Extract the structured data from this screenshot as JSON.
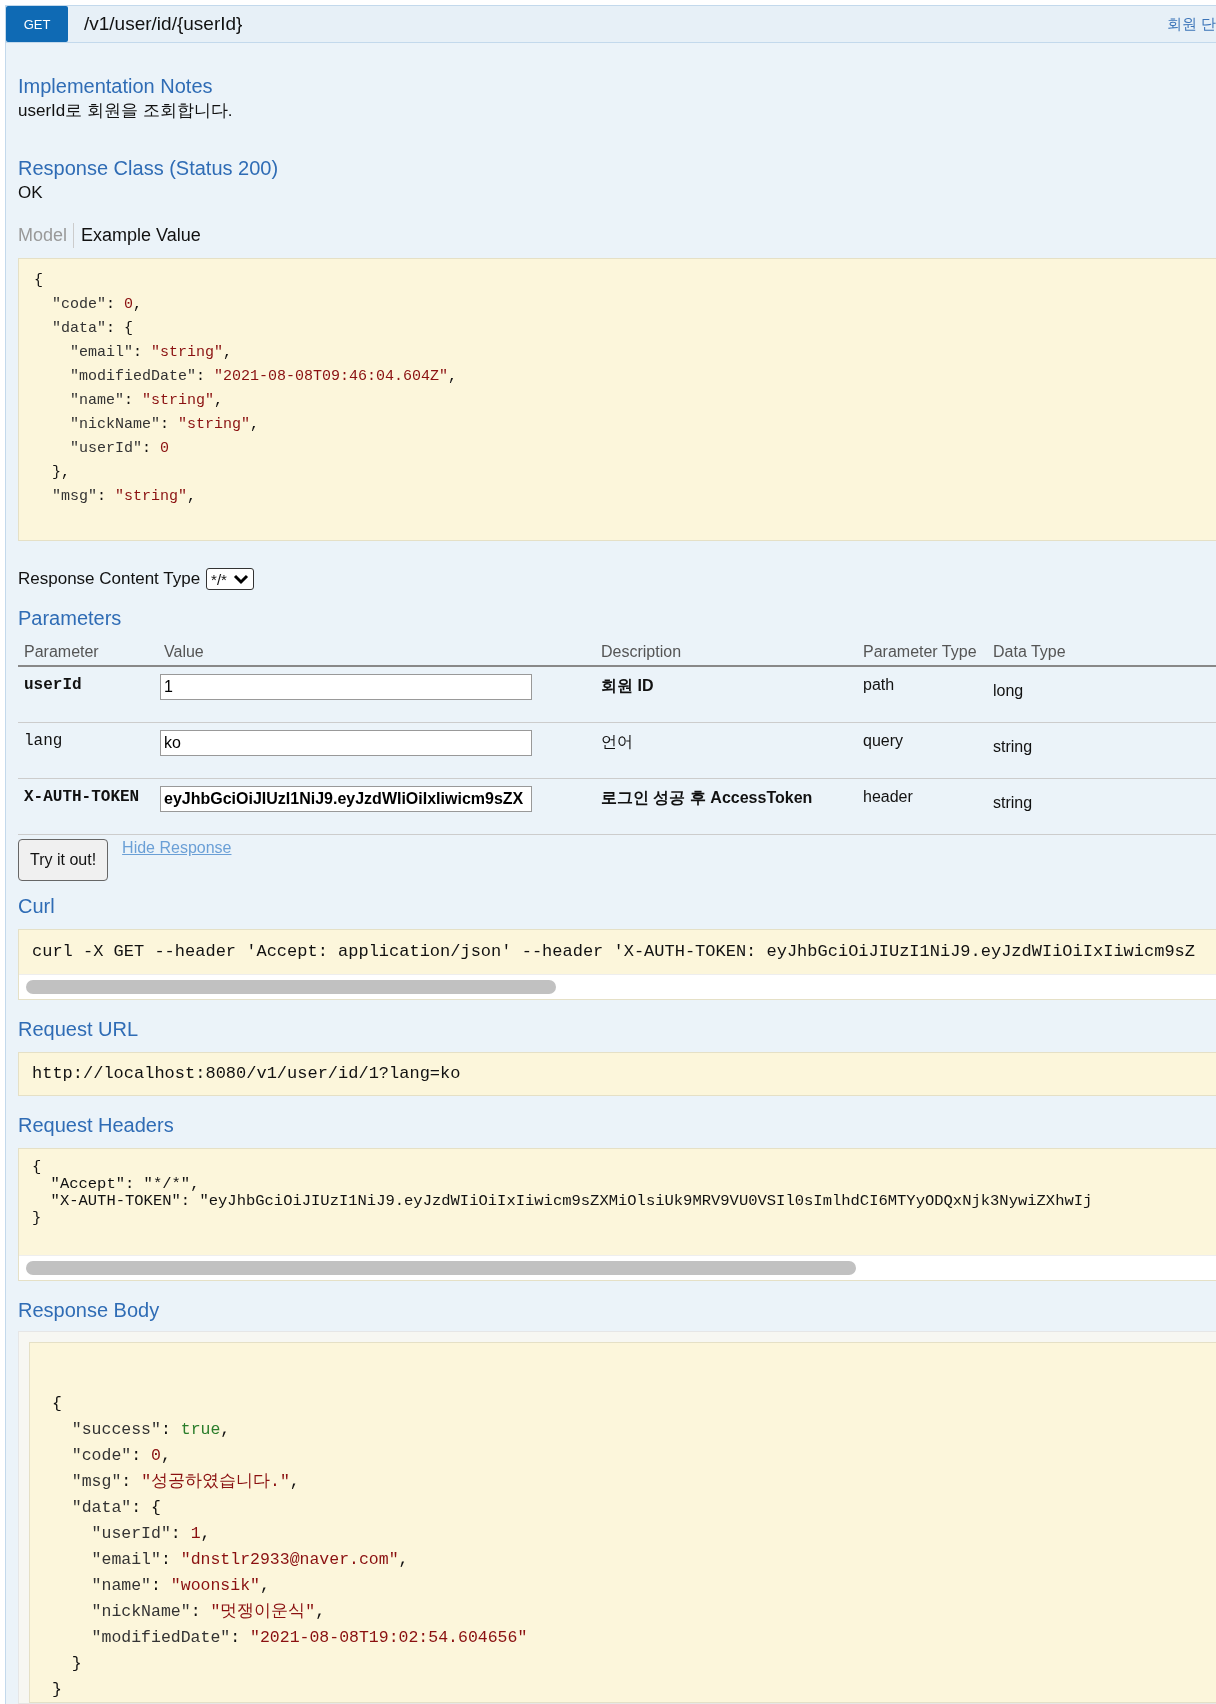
{
  "endpoint": {
    "method": "GET",
    "path": "/v1/user/id/{userId}",
    "summary": "회원 단"
  },
  "implementation_notes": {
    "title": "Implementation Notes",
    "text": "userId로 회원을 조회합니다."
  },
  "response_class": {
    "title": "Response Class (Status 200)",
    "text": "OK"
  },
  "model_tabs": [
    {
      "label": "Model",
      "selected": false
    },
    {
      "label": "Example Value",
      "selected": true
    }
  ],
  "example_value": [
    [
      {
        "kind": "punct",
        "text": "{"
      }
    ],
    [
      {
        "kind": "key",
        "text": "  \"code\""
      },
      {
        "kind": "punct",
        "text": ": "
      },
      {
        "kind": "number",
        "text": "0"
      },
      {
        "kind": "punct",
        "text": ","
      }
    ],
    [
      {
        "kind": "key",
        "text": "  \"data\""
      },
      {
        "kind": "punct",
        "text": ": {"
      }
    ],
    [
      {
        "kind": "key",
        "text": "    \"email\""
      },
      {
        "kind": "punct",
        "text": ": "
      },
      {
        "kind": "string",
        "text": "\"string\""
      },
      {
        "kind": "punct",
        "text": ","
      }
    ],
    [
      {
        "kind": "key",
        "text": "    \"modifiedDate\""
      },
      {
        "kind": "punct",
        "text": ": "
      },
      {
        "kind": "string",
        "text": "\"2021-08-08T09:46:04.604Z\""
      },
      {
        "kind": "punct",
        "text": ","
      }
    ],
    [
      {
        "kind": "key",
        "text": "    \"name\""
      },
      {
        "kind": "punct",
        "text": ": "
      },
      {
        "kind": "string",
        "text": "\"string\""
      },
      {
        "kind": "punct",
        "text": ","
      }
    ],
    [
      {
        "kind": "key",
        "text": "    \"nickName\""
      },
      {
        "kind": "punct",
        "text": ": "
      },
      {
        "kind": "string",
        "text": "\"string\""
      },
      {
        "kind": "punct",
        "text": ","
      }
    ],
    [
      {
        "kind": "key",
        "text": "    \"userId\""
      },
      {
        "kind": "punct",
        "text": ": "
      },
      {
        "kind": "number",
        "text": "0"
      }
    ],
    [
      {
        "kind": "punct",
        "text": "  },"
      }
    ],
    [
      {
        "kind": "key",
        "text": "  \"msg\""
      },
      {
        "kind": "punct",
        "text": ": "
      },
      {
        "kind": "string",
        "text": "\"string\""
      },
      {
        "kind": "punct",
        "text": ","
      }
    ]
  ],
  "response_content_type": {
    "label": "Response Content Type",
    "value": "*/*"
  },
  "parameters": {
    "title": "Parameters",
    "columns": [
      "Parameter",
      "Value",
      "Description",
      "Parameter Type",
      "Data Type"
    ],
    "rows": [
      {
        "name": "userId",
        "required": true,
        "value": "1",
        "description": "회원 ID",
        "parameter_type": "path",
        "data_type": "long"
      },
      {
        "name": "lang",
        "required": false,
        "value": "ko",
        "description": "언어",
        "parameter_type": "query",
        "data_type": "string"
      },
      {
        "name": "X-AUTH-TOKEN",
        "required": true,
        "value": "eyJhbGciOiJIUzI1NiJ9.eyJzdWIiOiIxIiwicm9sZX",
        "description": "로그인 성공 후 AccessToken",
        "parameter_type": "header",
        "data_type": "string"
      }
    ]
  },
  "actions": {
    "try_button": "Try it out!",
    "hide_link": "Hide Response"
  },
  "curl": {
    "title": "Curl",
    "command": "curl -X GET --header 'Accept: application/json' --header 'X-AUTH-TOKEN: eyJhbGciOiJIUzI1NiJ9.eyJzdWIiOiIxIiwicm9sZ"
  },
  "request_url": {
    "title": "Request URL",
    "url": "http://localhost:8080/v1/user/id/1?lang=ko"
  },
  "request_headers": {
    "title": "Request Headers",
    "lines": [
      "{",
      "  \"Accept\": \"*/*\",",
      "  \"X-AUTH-TOKEN\": \"eyJhbGciOiJIUzI1NiJ9.eyJzdWIiOiIxIiwicm9sZXMiOlsiUk9MRV9VU0VSIl0sImlhdCI6MTYyODQxNjk3NywiZXhwIj",
      "}"
    ]
  },
  "response_body": {
    "title": "Response Body",
    "lines": [
      [
        {
          "kind": "punct",
          "text": "{"
        }
      ],
      [
        {
          "kind": "key",
          "text": "  \"success\""
        },
        {
          "kind": "punct",
          "text": ": "
        },
        {
          "kind": "bool",
          "text": "true"
        },
        {
          "kind": "punct",
          "text": ","
        }
      ],
      [
        {
          "kind": "key",
          "text": "  \"code\""
        },
        {
          "kind": "punct",
          "text": ": "
        },
        {
          "kind": "number",
          "text": "0"
        },
        {
          "kind": "punct",
          "text": ","
        }
      ],
      [
        {
          "kind": "key",
          "text": "  \"msg\""
        },
        {
          "kind": "punct",
          "text": ": "
        },
        {
          "kind": "string",
          "text": "\"성공하였습니다.\""
        },
        {
          "kind": "punct",
          "text": ","
        }
      ],
      [
        {
          "kind": "key",
          "text": "  \"data\""
        },
        {
          "kind": "punct",
          "text": ": {"
        }
      ],
      [
        {
          "kind": "key",
          "text": "    \"userId\""
        },
        {
          "kind": "punct",
          "text": ": "
        },
        {
          "kind": "number",
          "text": "1"
        },
        {
          "kind": "punct",
          "text": ","
        }
      ],
      [
        {
          "kind": "key",
          "text": "    \"email\""
        },
        {
          "kind": "punct",
          "text": ": "
        },
        {
          "kind": "string",
          "text": "\"dnstlr2933@naver.com\""
        },
        {
          "kind": "punct",
          "text": ","
        }
      ],
      [
        {
          "kind": "key",
          "text": "    \"name\""
        },
        {
          "kind": "punct",
          "text": ": "
        },
        {
          "kind": "string",
          "text": "\"woonsik\""
        },
        {
          "kind": "punct",
          "text": ","
        }
      ],
      [
        {
          "kind": "key",
          "text": "    \"nickName\""
        },
        {
          "kind": "punct",
          "text": ": "
        },
        {
          "kind": "string",
          "text": "\"멋쟁이운식\""
        },
        {
          "kind": "punct",
          "text": ","
        }
      ],
      [
        {
          "kind": "key",
          "text": "    \"modifiedDate\""
        },
        {
          "kind": "punct",
          "text": ": "
        },
        {
          "kind": "string",
          "text": "\"2021-08-08T19:02:54.604656\""
        }
      ],
      [
        {
          "kind": "punct",
          "text": "  }"
        }
      ],
      [
        {
          "kind": "punct",
          "text": "}"
        }
      ]
    ]
  }
}
